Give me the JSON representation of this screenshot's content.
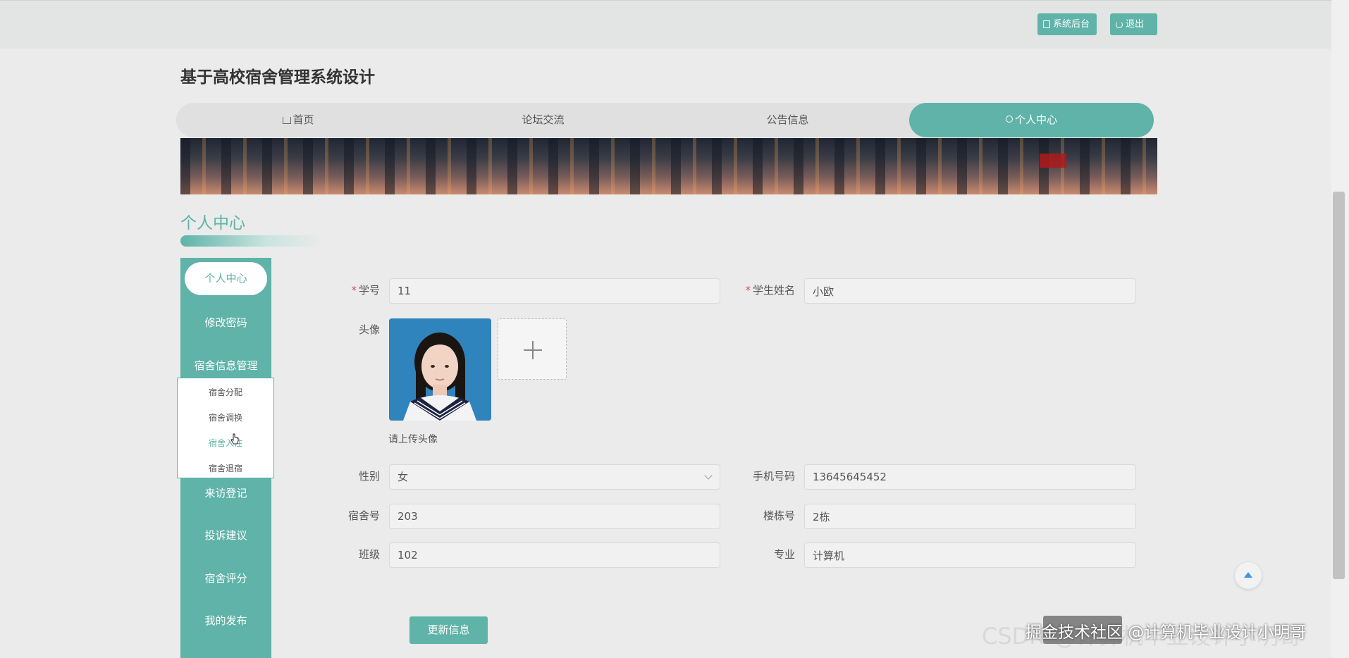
{
  "header": {
    "admin_button": "系统后台",
    "logout_button": "退出",
    "site_title": "基于高校宿舍管理系统设计"
  },
  "nav": {
    "items": [
      {
        "label": "首页",
        "icon": "home-icon"
      },
      {
        "label": "论坛交流"
      },
      {
        "label": "公告信息"
      },
      {
        "label": "个人中心",
        "icon": "user-icon",
        "active": true
      }
    ]
  },
  "section": {
    "title": "个人中心"
  },
  "sidebar": {
    "items": [
      {
        "label": "个人中心",
        "active": true
      },
      {
        "label": "修改密码"
      },
      {
        "label": "宿舍信息管理"
      },
      {
        "label": "来访登记"
      },
      {
        "label": "投诉建议"
      },
      {
        "label": "宿舍评分"
      },
      {
        "label": "我的发布"
      }
    ],
    "submenu": [
      {
        "label": "宿舍分配"
      },
      {
        "label": "宿舍调换"
      },
      {
        "label": "宿舍入住",
        "hover": true
      },
      {
        "label": "宿舍退宿"
      }
    ]
  },
  "form": {
    "student_id": {
      "label": "学号",
      "value": "11",
      "required": true
    },
    "student_name": {
      "label": "学生姓名",
      "value": "小欧",
      "required": true
    },
    "avatar": {
      "label": "头像",
      "hint": "请上传头像"
    },
    "gender": {
      "label": "性别",
      "value": "女"
    },
    "phone": {
      "label": "手机号码",
      "value": "13645645452"
    },
    "dorm_no": {
      "label": "宿舍号",
      "value": "203"
    },
    "building_no": {
      "label": "楼栋号",
      "value": "2栋"
    },
    "class": {
      "label": "班级",
      "value": "102"
    },
    "major": {
      "label": "专业",
      "value": "计算机"
    },
    "submit": "更新信息"
  },
  "watermark": {
    "text1": "掘金技术社区 @计算机毕业设计小明哥",
    "text2": "CSDN @计算机毕业设计小明哥"
  },
  "colors": {
    "accent": "#5fb3a8",
    "required": "#e14b4b"
  }
}
